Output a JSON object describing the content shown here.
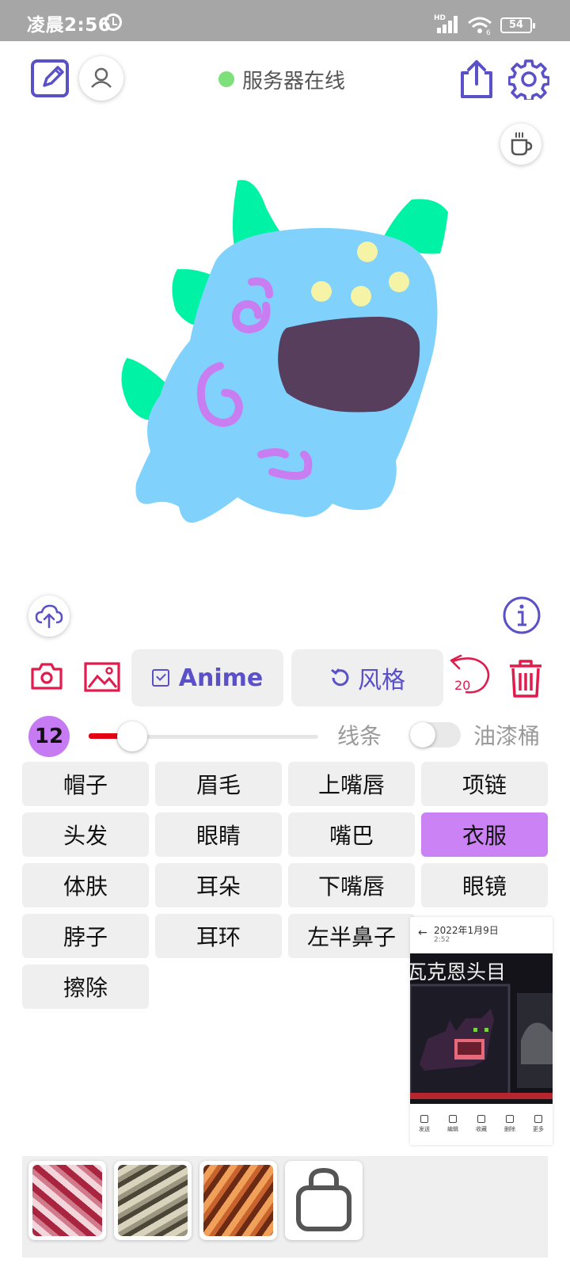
{
  "status_bar": {
    "time": "凌晨2:56",
    "network": "HD",
    "wifi_sub": "6",
    "battery": "54",
    "icons": [
      "alarm-icon",
      "signal-icon",
      "wifi-icon",
      "battery-icon"
    ]
  },
  "header": {
    "server_status": "服务器在线",
    "server_status_color": "#7de07a",
    "icons": [
      "edit-icon",
      "user-icon",
      "share-icon",
      "settings-icon",
      "coffee-icon"
    ]
  },
  "canvas": {
    "icons": [
      "upload-icon",
      "info-icon"
    ]
  },
  "toolbar": {
    "anime_label": "Anime",
    "style_label": "风格",
    "undo_count": "20",
    "icons": [
      "camera-icon",
      "image-icon",
      "undo-icon",
      "trash-icon"
    ]
  },
  "brush": {
    "size": "12",
    "slider_fraction": 0.19,
    "slider_color": "#e40014",
    "lines_label": "线条",
    "bucket_label": "油漆桶",
    "bucket_enabled": false
  },
  "parts": [
    {
      "label": "帽子",
      "active": false
    },
    {
      "label": "眉毛",
      "active": false
    },
    {
      "label": "上嘴唇",
      "active": false
    },
    {
      "label": "项链",
      "active": false
    },
    {
      "label": "头发",
      "active": false
    },
    {
      "label": "眼睛",
      "active": false
    },
    {
      "label": "嘴巴",
      "active": false
    },
    {
      "label": "衣服",
      "active": true
    },
    {
      "label": "体肤",
      "active": false
    },
    {
      "label": "耳朵",
      "active": false
    },
    {
      "label": "下嘴唇",
      "active": false
    },
    {
      "label": "眼镜",
      "active": false
    },
    {
      "label": "脖子",
      "active": false
    },
    {
      "label": "耳环",
      "active": false
    },
    {
      "label": "左半鼻子",
      "active": false
    },
    {
      "label": "",
      "active": false
    },
    {
      "label": "擦除",
      "active": false
    }
  ],
  "screenshot_preview": {
    "date": "2022年1月9日",
    "time": "2:52",
    "caption": "瓦克恩头目",
    "actions": [
      "发送",
      "编辑",
      "收藏",
      "删除",
      "更多"
    ]
  },
  "colors": {
    "accent": "#5a50c8",
    "danger": "#e01c4c",
    "active_part": "#cb82f4",
    "brush_badge": "#c67bf2"
  }
}
